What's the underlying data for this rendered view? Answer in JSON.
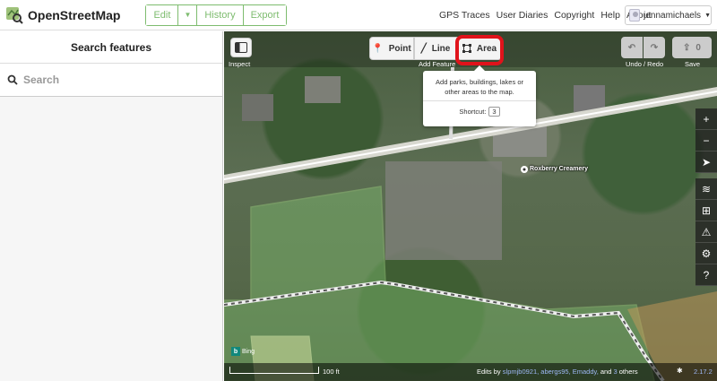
{
  "header": {
    "app_name": "OpenStreetMap",
    "buttons": {
      "edit": "Edit",
      "history": "History",
      "export": "Export"
    },
    "nav": [
      "GPS Traces",
      "User Diaries",
      "Copyright",
      "Help",
      "About"
    ],
    "user": "jennamichaels"
  },
  "sidebar": {
    "title": "Search features",
    "search_placeholder": "Search"
  },
  "toolbar": {
    "inspect_label": "Inspect",
    "point_label": "Point",
    "line_label": "Line",
    "area_label": "Area",
    "add_feature_label": "Add Feature",
    "undo_redo_label": "Undo / Redo",
    "save_label": "Save",
    "save_count": "0"
  },
  "tooltip": {
    "text": "Add parks, buildings, lakes or other areas to the map.",
    "shortcut_label": "Shortcut:",
    "shortcut_key": "3"
  },
  "map": {
    "poi_name": "Roxberry Creamery",
    "scale_label": "100 ft",
    "imagery": "Bing",
    "credits_prefix": "Edits by",
    "credits_users": "slpmjb0921, abergs95, Emaddy,",
    "credits_and": "and",
    "credits_count": "3",
    "credits_suffix": "others",
    "version": "2.17.2"
  },
  "colors": {
    "brand_green": "#7ebc6f",
    "highlight_red": "#e0131b"
  }
}
